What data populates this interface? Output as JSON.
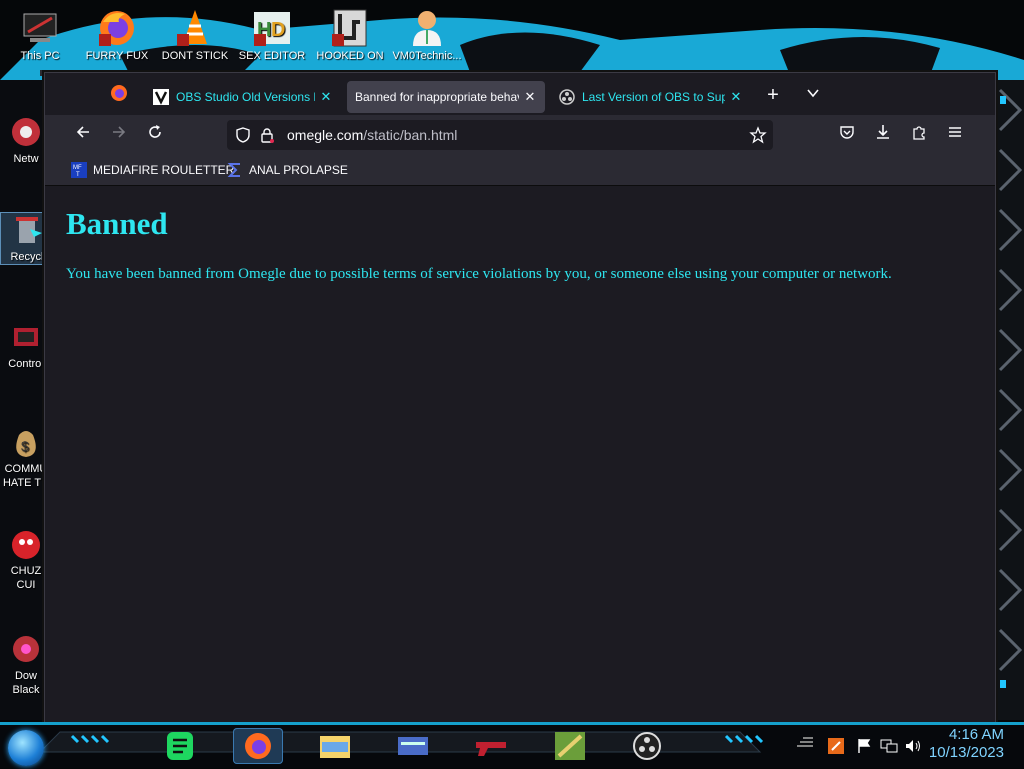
{
  "desktop": {
    "top_icons": [
      {
        "label": "This PC",
        "icon": "this-pc-icon"
      },
      {
        "label": "FURRY FUX",
        "icon": "firefox-icon"
      },
      {
        "label": "DONT STICK",
        "icon": "vlc-icon"
      },
      {
        "label": "SEX EDITOR",
        "icon": "hxd-icon"
      },
      {
        "label": "HOOKED ON",
        "icon": "game-icon"
      },
      {
        "label": "VM0Technic...",
        "icon": "doctor-icon"
      }
    ],
    "left_icons": [
      {
        "label": "Netw",
        "icon": "network-icon"
      },
      {
        "label": "Recycl",
        "icon": "recycle-bin-icon"
      },
      {
        "label": "Control",
        "icon": "control-panel-icon"
      },
      {
        "label": "COMMU",
        "label2": "HATE TH",
        "icon": "money-bag-icon"
      },
      {
        "label": "CHUZ",
        "label2": "CUI",
        "icon": "chuzzle-icon"
      },
      {
        "label": "Dow",
        "label2": "Black",
        "icon": "download-icon"
      }
    ]
  },
  "browser": {
    "tabs": [
      {
        "title": "OBS Studio Old Versions Do",
        "active": false,
        "icon": "veed-icon"
      },
      {
        "title": "Banned for inappropriate behav",
        "active": true,
        "icon": "none"
      },
      {
        "title": "Last Version of OBS to Supp",
        "active": false,
        "icon": "obs-icon"
      }
    ],
    "close_glyph": "✕",
    "new_tab_glyph": "+",
    "tab_list_glyph": "⌄",
    "url_host": "omegle.com",
    "url_path": "/static/ban.html",
    "bookmarks": [
      {
        "label": "MEDIAFIRE ROULETTER",
        "icon": "mediafire-icon"
      },
      {
        "label": "ANAL PROLAPSE",
        "icon": "sigma-icon"
      }
    ],
    "page": {
      "heading": "Banned",
      "message": "You have been banned from Omegle due to possible terms of service violations by you, or someone else using your computer or network."
    },
    "text_color": "#2ee6f0"
  },
  "taskbar": {
    "apps": [
      "spotify-icon",
      "firefox-icon",
      "file-explorer-icon",
      "card-icon",
      "gun-icon",
      "minecraft-sword-icon",
      "obs-icon"
    ],
    "time": "4:16 AM",
    "date": "10/13/2023"
  }
}
